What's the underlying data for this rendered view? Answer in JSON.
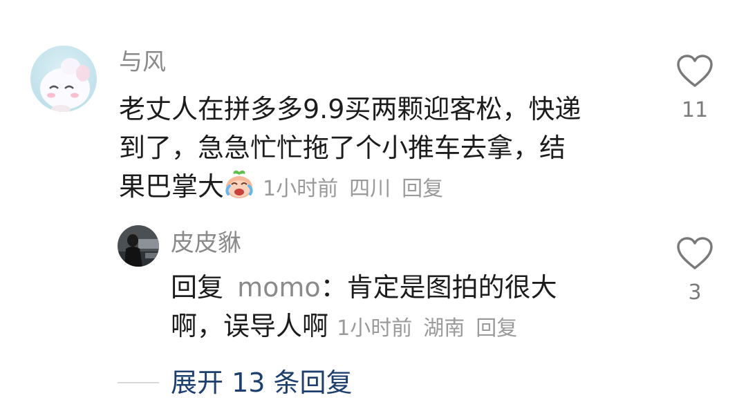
{
  "comment": {
    "username": "与风",
    "text_line1": "老丈人在拼多多9.9买两颗迎客松，快递",
    "text_line2": "到了，急急忙忙拖了个小推车去拿，结",
    "text_line3": "果巴掌大",
    "emoji": "crying-laughing-peach-emoji",
    "time": "1小时前",
    "location": "四川",
    "reply_label": "回复",
    "like_count": "11"
  },
  "reply": {
    "username": "皮皮貅",
    "reply_prefix": "回复",
    "mention": "momo",
    "separator": "：",
    "text_line1": "肯定是图拍的很大",
    "text_line2": "啊，误导人啊",
    "time": "1小时前",
    "location": "湖南",
    "reply_label": "回复",
    "like_count": "3"
  },
  "expand": {
    "label": "展开 13 条回复"
  },
  "colors": {
    "username": "#8a8a8a",
    "text": "#1c1c1c",
    "meta": "#9a9a9a",
    "link": "#1d3f6e"
  },
  "icons": {
    "like": "heart-outline-icon"
  }
}
